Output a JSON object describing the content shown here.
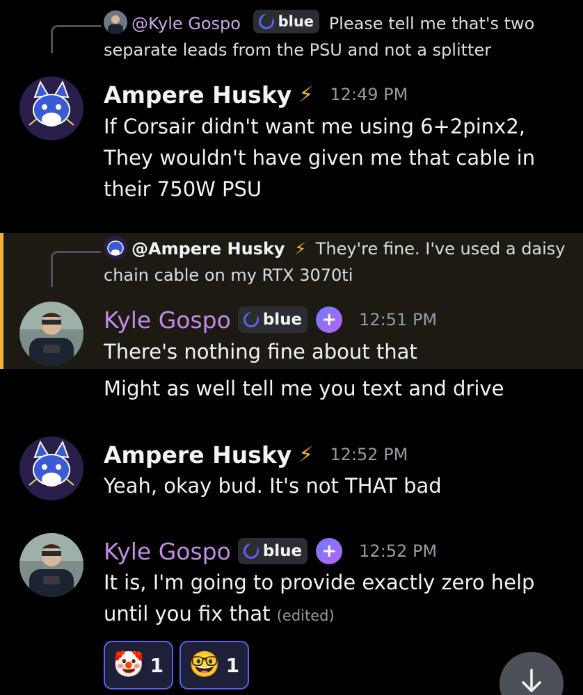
{
  "messages": [
    {
      "reply": {
        "name": "@Kyle Gospo",
        "tag": "blue",
        "text": "Please tell me that's two separate leads from the PSU and not a splitter"
      },
      "author": "Ampere Husky",
      "time": "12:49 PM",
      "lines": [
        "If Corsair didn't want me using 6+2pinx2, They wouldn't have given me that cable in their 750W PSU"
      ]
    },
    {
      "reply": {
        "name": "@Ampere Husky",
        "text": "They're fine. I've used a daisy chain cable on my RTX 3070ti"
      },
      "author": "Kyle Gospo",
      "tag": "blue",
      "time": "12:51 PM",
      "lines": [
        "There's nothing fine about that",
        "Might as well tell me you text and drive"
      ]
    },
    {
      "author": "Ampere Husky",
      "time": "12:52 PM",
      "lines": [
        "Yeah, okay bud. It's not THAT bad"
      ]
    },
    {
      "author": "Kyle Gospo",
      "tag": "blue",
      "time": "12:52 PM",
      "lines": [
        "It is, I'm going to provide exactly zero help until you fix that"
      ],
      "edited": "(edited)",
      "reactions": [
        {
          "emoji": "🤡",
          "icon": "clown-face-icon",
          "count": "1"
        },
        {
          "emoji": "🤓",
          "icon": "nerd-face-icon",
          "count": "1"
        }
      ]
    }
  ],
  "colors": {
    "highlight": "#f0b232",
    "kyle_name": "#c28be8",
    "blurple": "#5865f2"
  }
}
